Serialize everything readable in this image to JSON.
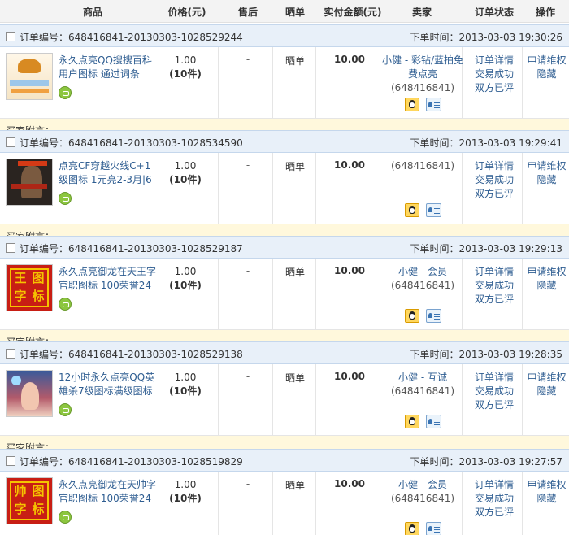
{
  "header": {
    "product": "商品",
    "price": "价格(元)",
    "after_sales": "售后",
    "share": "晒单",
    "paid": "实付金额(元)",
    "seller": "卖家",
    "status": "订单状态",
    "ops": "操作"
  },
  "labels": {
    "order_no_prefix": "订单编号：",
    "time_prefix": "下单时间：",
    "buyer_note_prefix": "买家附言："
  },
  "orders": [
    {
      "order_no": "648416841-20130303-1028529244",
      "time": "2013-03-03 19:30:26",
      "title": "永久点亮QQ搜搜百科用户图标 通过词条",
      "price": "1.00",
      "qty": "(10件)",
      "after_sales": "-",
      "share": "晒单",
      "paid": "10.00",
      "seller_name": "小健 - 彩钻/蓝拍免费点亮",
      "seller_id": "(648416841)",
      "status": [
        "订单详情",
        "交易成功",
        "双方已评"
      ],
      "ops": [
        "申请维权",
        "隐藏"
      ],
      "note": "买家附言：....",
      "thumb": "qq-baike-icon"
    },
    {
      "order_no": "648416841-20130303-1028534590",
      "time": "2013-03-03 19:29:41",
      "title": "点亮CF穿越火线C+1级图标 1元亮2-3月|6",
      "price": "1.00",
      "qty": "(10件)",
      "after_sales": "-",
      "share": "晒单",
      "paid": "10.00",
      "seller_name": "",
      "seller_id": "(648416841)",
      "status": [
        "订单详情",
        "交易成功",
        "双方已评"
      ],
      "ops": [
        "申请维权",
        "隐藏"
      ],
      "note": "买家附言：.......",
      "thumb": "cf-soldier-icon"
    },
    {
      "order_no": "648416841-20130303-1028529187",
      "time": "2013-03-03 19:29:13",
      "title": "永久点亮御龙在天王字官职图标 100荣誉24",
      "price": "1.00",
      "qty": "(10件)",
      "after_sales": "-",
      "share": "晒单",
      "paid": "10.00",
      "seller_name": "小健 - 会员",
      "seller_id": "(648416841)",
      "status": [
        "订单详情",
        "交易成功",
        "双方已评"
      ],
      "ops": [
        "申请维权",
        "隐藏"
      ],
      "note": "买家附言：....",
      "thumb": "wang-zi-icon",
      "thumb_text": [
        "王",
        "图",
        "字",
        "标"
      ]
    },
    {
      "order_no": "648416841-20130303-1028529138",
      "time": "2013-03-03 19:28:35",
      "title": "12小时永久点亮QQ英雄杀7级图标满级图标",
      "price": "1.00",
      "qty": "(10件)",
      "after_sales": "-",
      "share": "晒单",
      "paid": "10.00",
      "seller_name": "小健 - 互诚",
      "seller_id": "(648416841)",
      "status": [
        "订单详情",
        "交易成功",
        "双方已评"
      ],
      "ops": [
        "申请维权",
        "隐藏"
      ],
      "note": "买家附言：....",
      "thumb": "hero-kill-icon"
    },
    {
      "order_no": "648416841-20130303-1028519829",
      "time": "2013-03-03 19:27:57",
      "title": "永久点亮御龙在天帅字官职图标 100荣誉24",
      "price": "1.00",
      "qty": "(10件)",
      "after_sales": "-",
      "share": "晒单",
      "paid": "10.00",
      "seller_name": "小健 - 会员",
      "seller_id": "(648416841)",
      "status": [
        "订单详情",
        "交易成功",
        "双方已评"
      ],
      "ops": [
        "申请维权",
        "隐藏"
      ],
      "note": "",
      "thumb": "shuai-zi-icon",
      "thumb_text": [
        "帅",
        "图",
        "字",
        "标"
      ]
    }
  ]
}
